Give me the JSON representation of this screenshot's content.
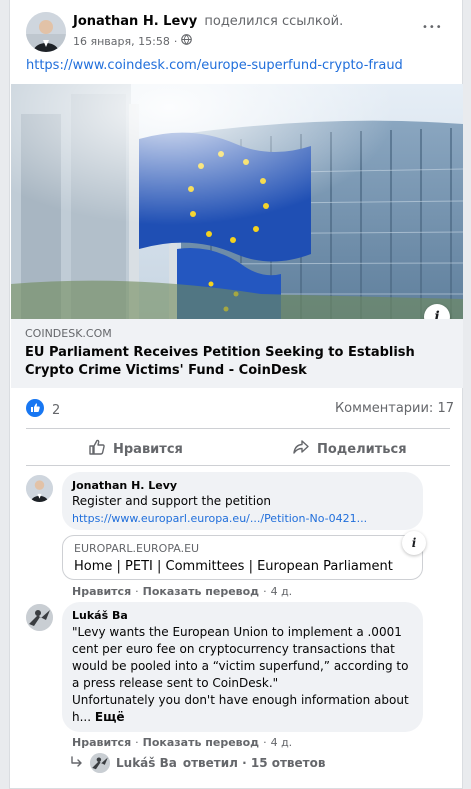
{
  "post": {
    "author": "Jonathan H. Levy",
    "action_text": "поделился ссылкой.",
    "date": "16 января, 15:58",
    "separator": "·",
    "shared_url": "https://www.coindesk.com/europe-superfund-crypto-fraud",
    "more_label": "•••"
  },
  "link_preview": {
    "domain": "COINDESK.COM",
    "title": "EU Parliament Receives Petition Seeking to Establish Crypto Crime Victims' Fund - CoinDesk",
    "info_label": "i"
  },
  "reactions": {
    "count": "2",
    "comments": "Комментарии: 17"
  },
  "actions": {
    "like": "Нравится",
    "share": "Поделиться"
  },
  "comments": [
    {
      "author": "Jonathan H. Levy",
      "text": "Register and support the petition",
      "link": "https://www.europarl.europa.eu/.../Petition-No-0421...",
      "preview_domain": "EUROPARL.EUROPA.EU",
      "preview_title": "Home | PETI | Committees | European Parliament",
      "like": "Нравится",
      "translate": "Показать перевод",
      "time": "4 д."
    },
    {
      "author": "Lukáš Ba",
      "text_lines": [
        "\"Levy wants the European Union to implement a .0001",
        "cent per euro fee on cryptocurrency transactions that",
        "would be pooled into a “victim superfund,” according to",
        "a press release sent to CoinDesk.\"",
        "Unfortunately you don't have enough information about",
        "h..."
      ],
      "more": "Ещё",
      "like": "Нравится",
      "translate": "Показать перевод",
      "time": "4 д."
    }
  ],
  "replies_summary": {
    "name": "Lukáš Ba",
    "text": "ответил · 15 ответов"
  },
  "colors": {
    "link": "#216fdb",
    "like_blue": "#1877f2",
    "muted": "#65676b",
    "bubble": "#f0f2f5"
  }
}
